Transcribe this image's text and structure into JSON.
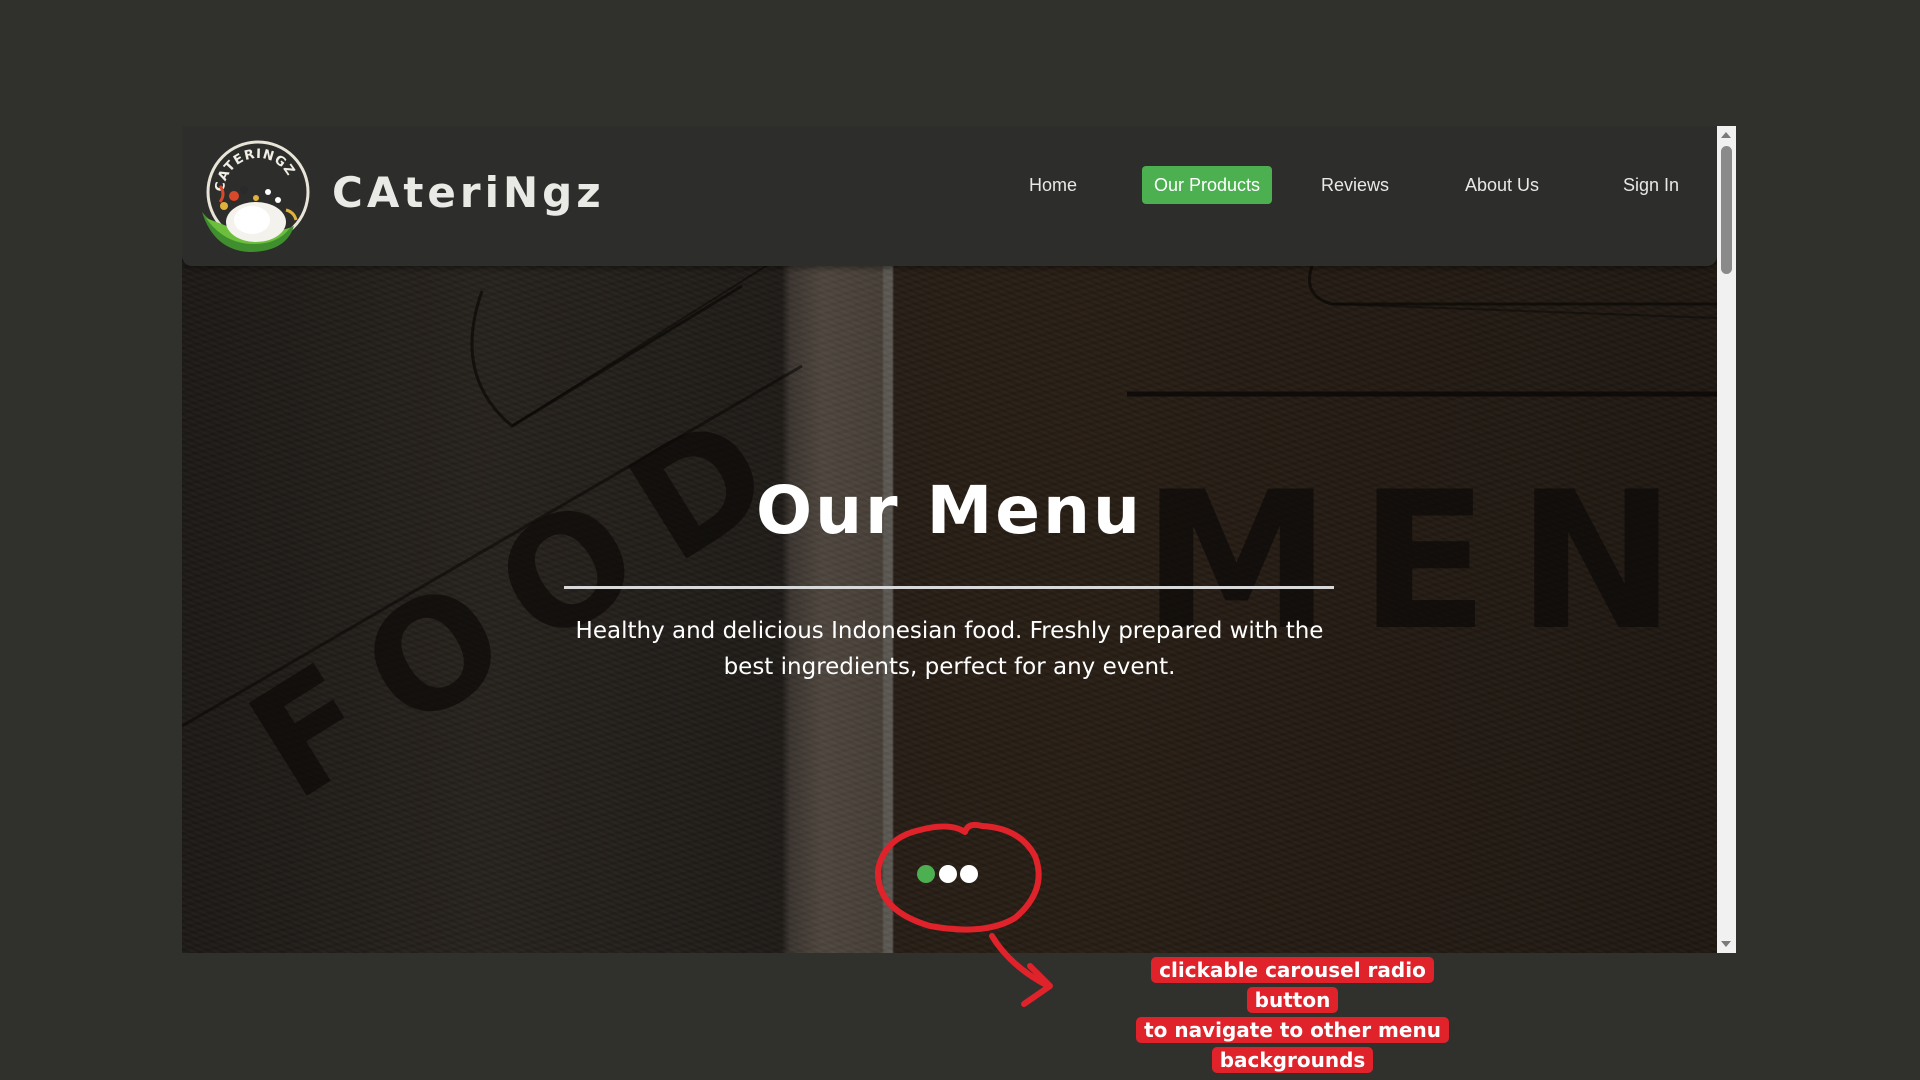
{
  "site": {
    "brand": "CAteriNgz",
    "logo_text": "CATERINGZ"
  },
  "nav": {
    "items": [
      {
        "label": "Home",
        "active": false
      },
      {
        "label": "Our Products",
        "active": true
      },
      {
        "label": "Reviews",
        "active": false
      },
      {
        "label": "About Us",
        "active": false
      },
      {
        "label": "Sign In",
        "active": false
      }
    ]
  },
  "hero": {
    "title": "Our Menu",
    "description": "Healthy and delicious Indonesian food. Freshly prepared with the best ingredients, perfect for any event.",
    "background_words": [
      "FOOD",
      "MENU"
    ],
    "carousel": {
      "count": 3,
      "active_index": 0
    }
  },
  "annotation": {
    "lines": [
      "clickable carousel radio button",
      "to navigate to other menu",
      "backgrounds"
    ],
    "color": "#e0222b"
  },
  "colors": {
    "accent": "#4caf50",
    "page_bg": "#30302c",
    "navbar_bg": "#2d2d2b"
  }
}
